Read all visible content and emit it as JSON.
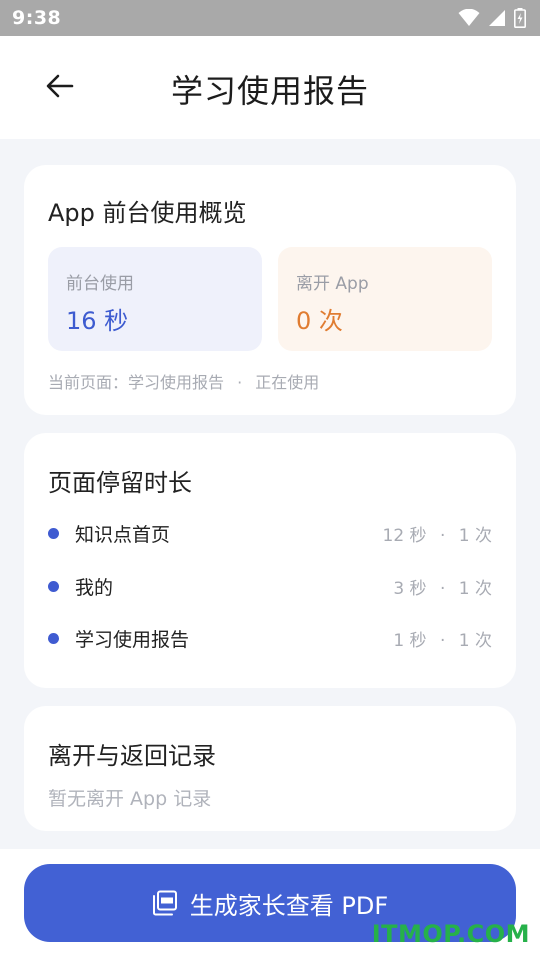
{
  "status_bar": {
    "time": "9:38",
    "icons": [
      "wifi-icon",
      "signal-icon",
      "battery-charging-icon"
    ]
  },
  "header": {
    "back_icon": "arrow-left-icon",
    "title": "学习使用报告"
  },
  "overview": {
    "title": "App 前台使用概览",
    "foreground": {
      "label": "前台使用",
      "value": "16 秒"
    },
    "leave": {
      "label": "离开 App",
      "value": "0 次"
    },
    "current_page_label": "当前页面：学习使用报告",
    "separator": "·",
    "current_state": "正在使用"
  },
  "duration": {
    "title": "页面停留时长",
    "items": [
      {
        "name": "知识点首页",
        "time": "12 秒",
        "count": "1 次"
      },
      {
        "name": "我的",
        "time": "3 秒",
        "count": "1 次"
      },
      {
        "name": "学习使用报告",
        "time": "1 秒",
        "count": "1 次"
      }
    ]
  },
  "leave_records": {
    "title": "离开与返回记录",
    "empty_text": "暂无离开 App 记录"
  },
  "bottom": {
    "pdf_icon": "pdf-document-icon",
    "pdf_button_label": "生成家长查看 PDF"
  },
  "watermark": "ITMOP.COM",
  "colors": {
    "accent": "#4261d4",
    "orange": "#e07c31",
    "background": "#f3f5f9",
    "watermark": "#26b14a"
  }
}
